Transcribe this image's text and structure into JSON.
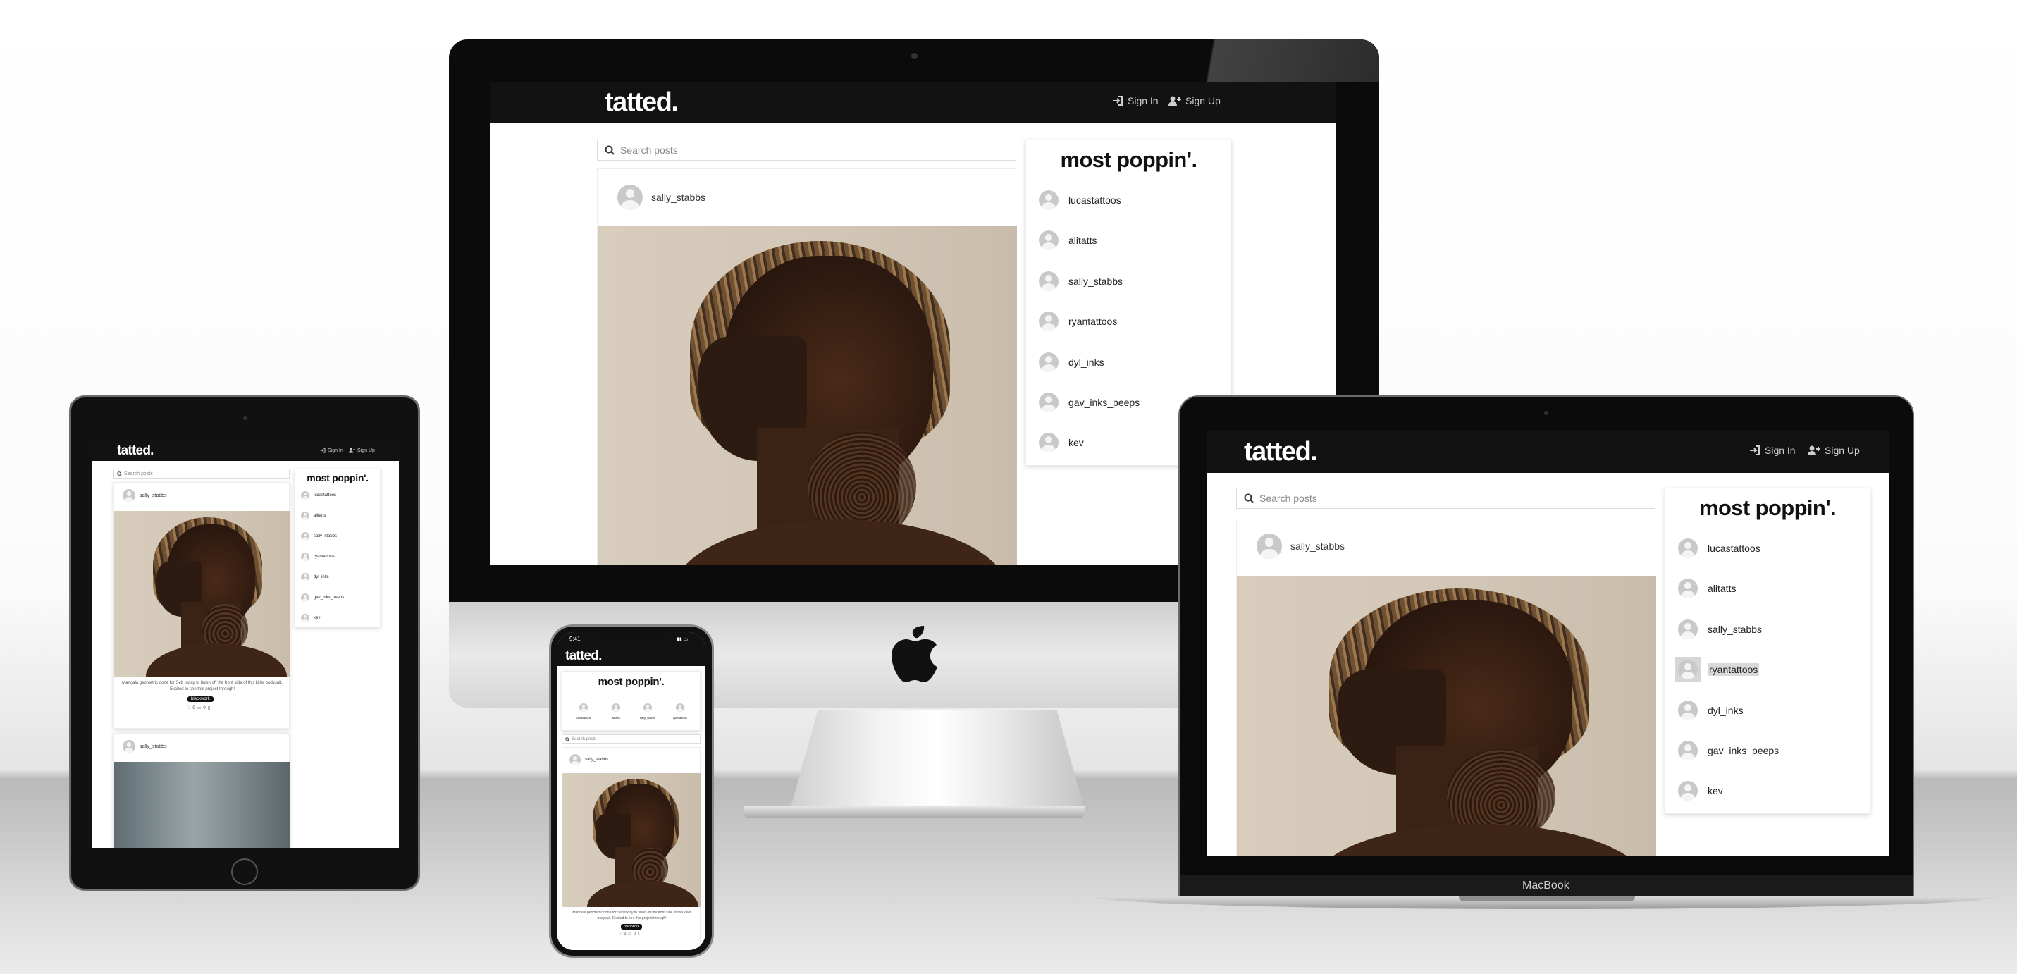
{
  "site": {
    "logo": "tatted.",
    "nav_sign_in": "Sign In",
    "nav_sign_up": "Sign Up",
    "search_placeholder": "Search posts",
    "sidebar_title": "most poppin'."
  },
  "popular_profiles": [
    "lucastattoos",
    "alitatts",
    "sally_stabbs",
    "ryantattoos",
    "dyl_inks",
    "gav_inks_peeps",
    "kev"
  ],
  "highlighted_profile": "ryantattoos",
  "post": {
    "author": "sally_stabbs",
    "caption": "Mandala geometric done for Seb today to finish off the front side of this killer bodysuit. Excited to see this project through!",
    "tag": "blackwork",
    "likes": "0",
    "comments": "0"
  },
  "second_post_author": "sally_stabbs",
  "phone": {
    "status_time": "9:41"
  },
  "laptop_label": "MacBook",
  "colors": {
    "navbar": "#121212",
    "accent": "#111111",
    "background": "#ffffff"
  }
}
